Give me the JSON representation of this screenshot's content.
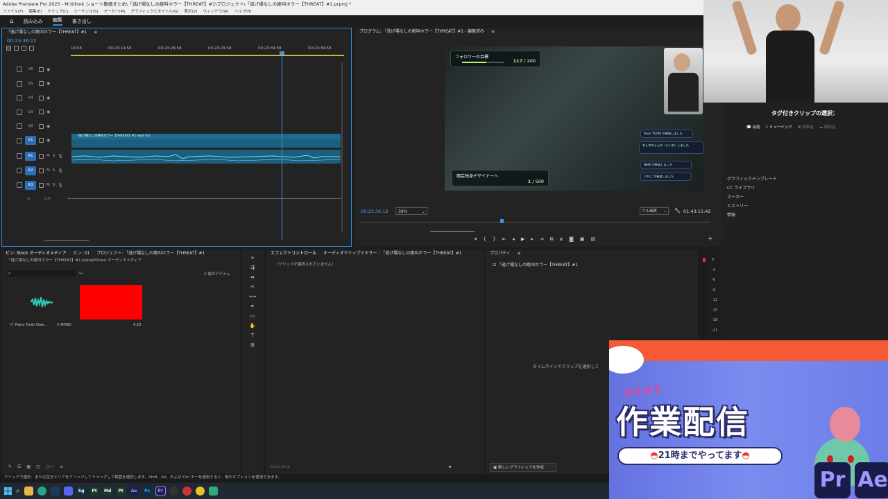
{
  "window": {
    "title": "Adobe Premiere Pro 2025 - M:\\tiktok ショート動画まとめ\\「逃げ場なしの絶叫ホラー【THREAT】#1\\プロジェクト\\「逃げ場なしの絶叫ホラー【THREAT】#1.prproj *"
  },
  "menu": [
    "ファイル(F)",
    "編集(E)",
    "クリップ(C)",
    "シーケンス(S)",
    "マーカー(M)",
    "グラフィックとタイトル(G)",
    "表示(V)",
    "ウィンドウ(W)",
    "ヘルプ(H)"
  ],
  "workspace_tabs": [
    "読み込み",
    "編集",
    "書き出し"
  ],
  "timeline": {
    "tab_label": "「逃げ場なしの絶叫ホラー【THREAT】#1",
    "timecode": "00:23:36:12",
    "ruler": [
      "14:58",
      "00:23:19:58",
      "00:23:24:58",
      "00:23:29:58",
      "00:23:34:58",
      "00:23:39:58"
    ],
    "video_tracks": [
      "V6",
      "V5",
      "V4",
      "V3",
      "V2",
      "V1"
    ],
    "audio_tracks": [
      "A1",
      "A2",
      "A3"
    ],
    "mix_label": "ミ...",
    "mix_value": "0.0",
    "clip_label": "「逃げ場なしの絶叫ホラー【THREAT】#1.mp4 [V]",
    "track_icons": {
      "m": "M",
      "s": "S"
    }
  },
  "program": {
    "tab_label": "プログラム: 「逃げ場なしの絶叫ホラー【THREAT】#1 - 編集済み",
    "timecode": "00:23:36:12",
    "zoom": "39%",
    "quality": "フル画質",
    "duration": "01:43:11:42",
    "hud_goal_label": "フォロワーの目標",
    "hud_goal_count": "117",
    "hud_goal_total": "200",
    "hud_goal_fill": 0.585,
    "hud_sub_label": "顔芸独身デザイナーへ",
    "hud_sub_count": "1",
    "hud_sub_total": "500",
    "chat": [
      "Raoo T1000 が参加しました",
      "おしのちゃんが（いいね）しました",
      "NAGI が参加しました",
      "うちこ が参加しました"
    ]
  },
  "project": {
    "tabs": [
      "ビン: Stock オーディオメディア",
      "ビン: 01",
      "プロジェクト: 「逃げ場なしの絶叫ホラー【THREAT】#1"
    ],
    "path": "「逃げ場なしの絶叫ホラー【THREAT】#1.prproj¥Stock オーディオメディア",
    "item_count": "2 個のアイテム",
    "items": [
      {
        "name": "Piano Trails Slow...",
        "duration": "5:40560"
      },
      {
        "name": "",
        "duration": "4:23"
      }
    ]
  },
  "effects": {
    "tabs": [
      "エフェクトコントロール",
      "オーディオクリップミキサー : 「逃げ場なしの絶叫ホラー【THREAT】#1"
    ],
    "no_clip": "（クリップが選択されていません）",
    "timecode": "00:23:36:12"
  },
  "properties": {
    "tab_label": "プロパティ",
    "sequence_name": "「逃げ場なしの絶叫ホラー【THREAT】#1",
    "hint": "タイムラインでクリップを選択して",
    "new_graphic": "新しいグラフィックを作成"
  },
  "meter_labels": [
    "0",
    "-3",
    "-6",
    "-9",
    "-12",
    "-15",
    "-18",
    "-21"
  ],
  "right_panel": {
    "title": "タグ付きクリップの選択：",
    "tags": [
      "会話",
      "ミュージック",
      "効果音",
      "環境音"
    ],
    "list": [
      "グラフィックテンプレート",
      "CC ライブラリ",
      "マーカー",
      "ヒストリー",
      "情報"
    ]
  },
  "status_bar": "クリックで選択、または空きエリアをクリックしてドラッグして範囲を選択します。Shift、Alt、および Ctrl キーを使用すると、他のオプションを使用できます。",
  "banner": {
    "small": "ダネダネ",
    "title": "作業配信",
    "subtitle": "21時までやってます",
    "app1": "Pr",
    "app2": "Ae"
  },
  "taskbar_icons": [
    "Sg",
    "Pt",
    "Md",
    "Pt",
    "Ae",
    "Ps",
    "Pr"
  ],
  "colors": {
    "accent": "#2d8ceb",
    "track_clip": "#1f6b8f",
    "red_swatch": "#ff0000",
    "premiere": "#9999ff"
  }
}
